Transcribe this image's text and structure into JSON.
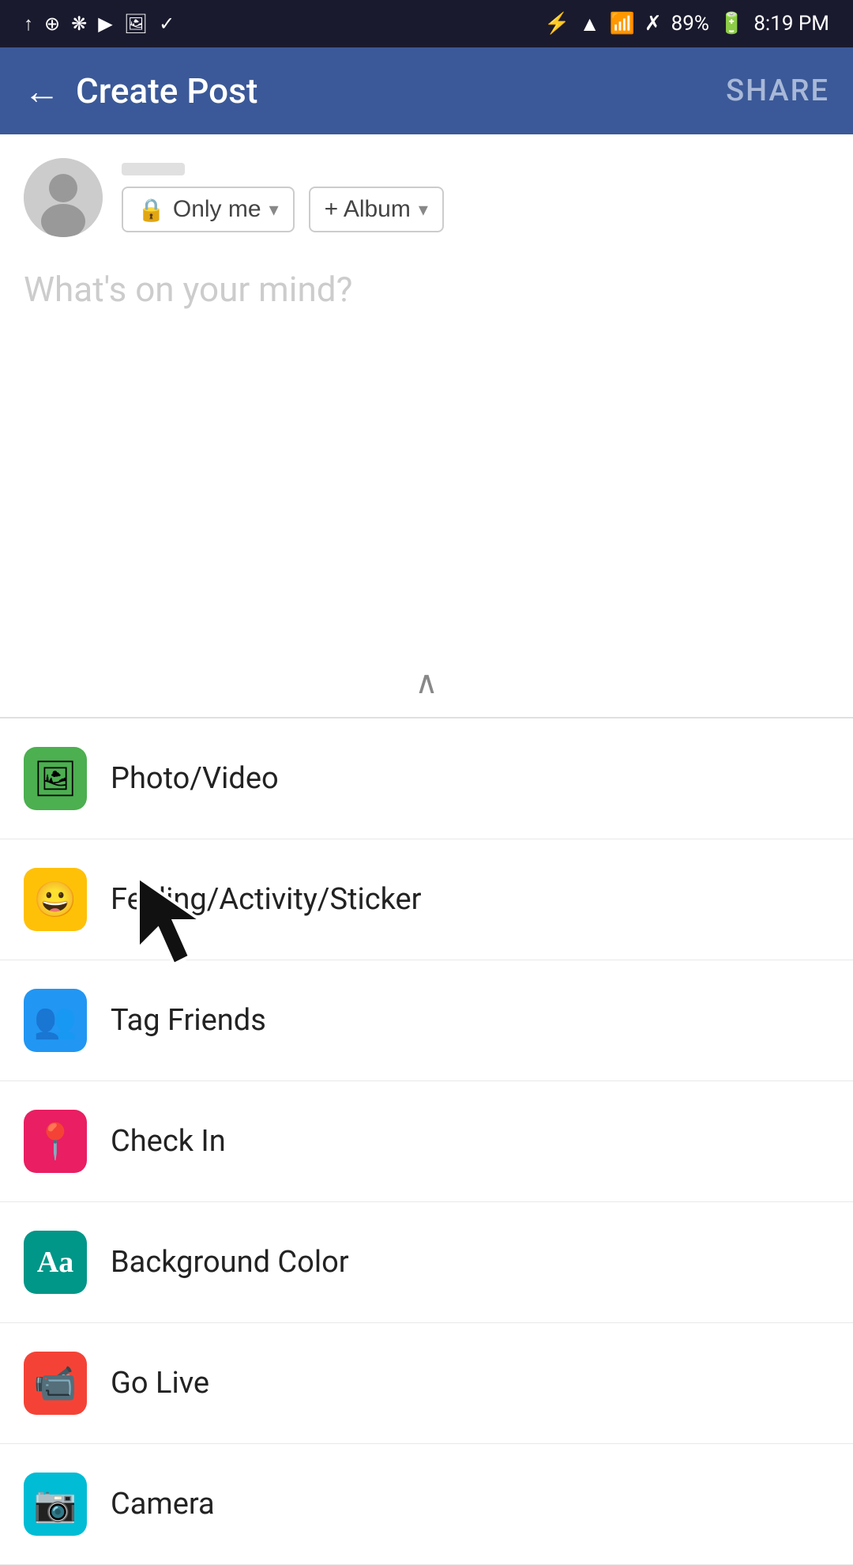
{
  "statusBar": {
    "battery": "89%",
    "time": "8:19 PM"
  },
  "navBar": {
    "title": "Create Post",
    "backLabel": "←",
    "shareLabel": "SHARE"
  },
  "composer": {
    "privacyLabel": "Only me",
    "albumLabel": "+ Album",
    "placeholder": "What's on your mind?"
  },
  "menuItems": [
    {
      "id": "photo-video",
      "label": "Photo/Video",
      "iconColor": "green",
      "iconSymbol": "🖼"
    },
    {
      "id": "feeling-activity",
      "label": "Feeling/Activity/Sticker",
      "iconColor": "yellow",
      "iconSymbol": "😀"
    },
    {
      "id": "tag-friends",
      "label": "Tag Friends",
      "iconColor": "blue",
      "iconSymbol": "👥"
    },
    {
      "id": "check-in",
      "label": "Check In",
      "iconColor": "pink",
      "iconSymbol": "📍"
    },
    {
      "id": "background-color",
      "label": "Background Color",
      "iconColor": "teal",
      "iconSymbol": "Aa"
    },
    {
      "id": "go-live",
      "label": "Go Live",
      "iconColor": "red",
      "iconSymbol": "📹"
    },
    {
      "id": "camera",
      "label": "Camera",
      "iconColor": "cyan",
      "iconSymbol": "📷"
    }
  ],
  "colors": {
    "navBg": "#3b5998",
    "statusBg": "#1a1a2e",
    "iconGreen": "#4CAF50",
    "iconYellow": "#FFC107",
    "iconBlue": "#2196F3",
    "iconPink": "#E91E63",
    "iconTeal": "#009688",
    "iconRed": "#F44336",
    "iconCyan": "#00BCD4"
  }
}
